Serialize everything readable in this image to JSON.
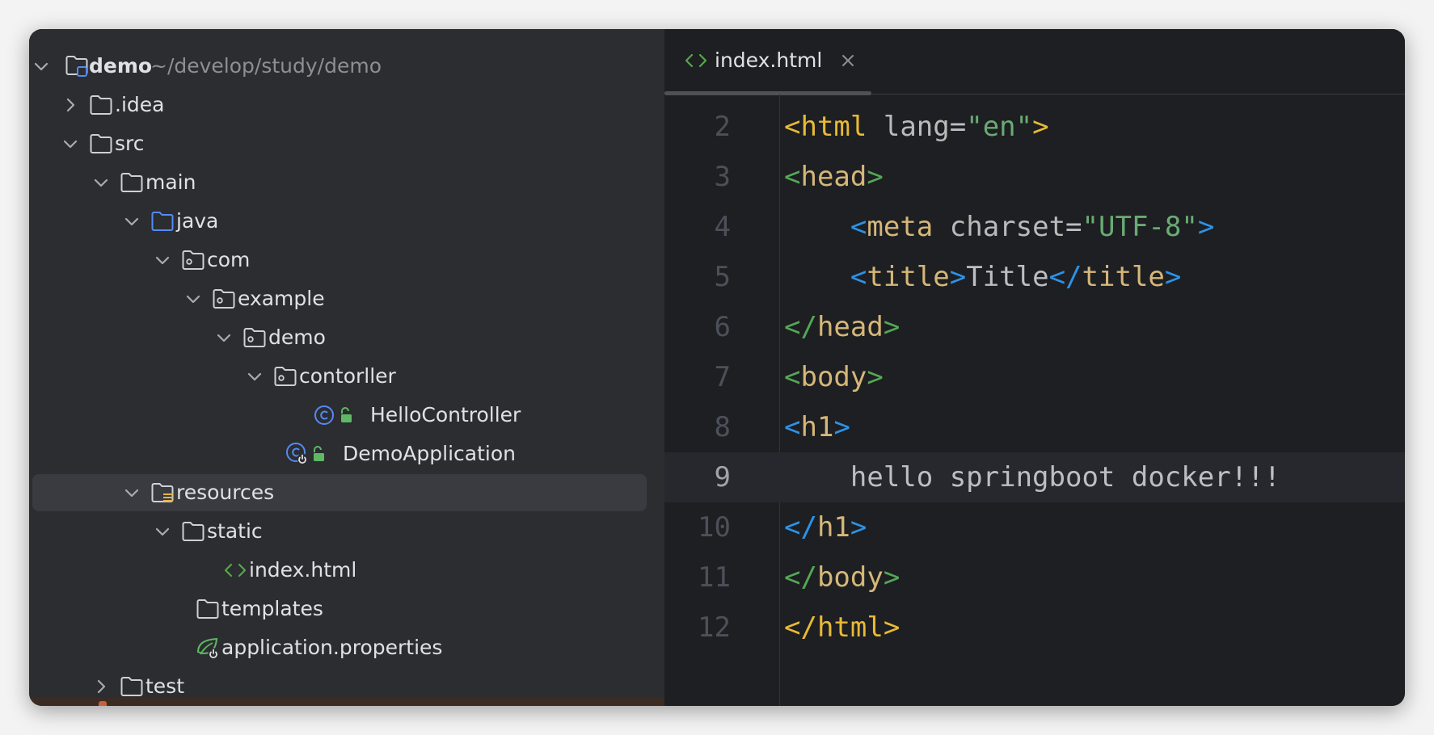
{
  "project_tree": {
    "root": {
      "name": "demo",
      "path": "~/develop/study/demo"
    },
    "items": [
      {
        "label": ".idea",
        "icon": "folder-icon",
        "expanded": false
      },
      {
        "label": "src",
        "icon": "folder-icon",
        "expanded": true
      },
      {
        "label": "main",
        "icon": "folder-icon",
        "expanded": true
      },
      {
        "label": "java",
        "icon": "source-folder-icon",
        "expanded": true
      },
      {
        "label": "com",
        "icon": "package-icon",
        "expanded": true
      },
      {
        "label": "example",
        "icon": "package-icon",
        "expanded": true
      },
      {
        "label": "demo",
        "icon": "package-icon",
        "expanded": true
      },
      {
        "label": "contorller",
        "icon": "package-icon",
        "expanded": true
      },
      {
        "label": "HelloController",
        "icon": "java-class-icon"
      },
      {
        "label": "DemoApplication",
        "icon": "spring-boot-class-icon"
      },
      {
        "label": "resources",
        "icon": "resources-folder-icon",
        "expanded": true,
        "selected": true
      },
      {
        "label": "static",
        "icon": "folder-icon",
        "expanded": true
      },
      {
        "label": "index.html",
        "icon": "html-file-icon"
      },
      {
        "label": "templates",
        "icon": "folder-icon"
      },
      {
        "label": "application.properties",
        "icon": "spring-properties-icon"
      },
      {
        "label": "test",
        "icon": "folder-icon",
        "expanded": false
      }
    ]
  },
  "editor": {
    "tab": {
      "label": "index.html",
      "icon": "html-file-icon"
    },
    "current_line": "9",
    "lines": [
      {
        "number": "2",
        "tokens": [
          [
            "<",
            "orange"
          ],
          [
            "html",
            "orange"
          ],
          [
            " ",
            "text"
          ],
          [
            "lang",
            "attr"
          ],
          [
            "=",
            "eq"
          ],
          [
            "\"en\"",
            "str"
          ],
          [
            ">",
            "orange"
          ]
        ]
      },
      {
        "number": "3",
        "tokens": [
          [
            "<",
            "green"
          ],
          [
            "head",
            "tag"
          ],
          [
            ">",
            "green"
          ]
        ]
      },
      {
        "number": "4",
        "tokens": [
          [
            "    ",
            "text"
          ],
          [
            "<",
            "blue"
          ],
          [
            "meta",
            "tag"
          ],
          [
            " ",
            "text"
          ],
          [
            "charset",
            "attr"
          ],
          [
            "=",
            "eq"
          ],
          [
            "\"UTF-8\"",
            "str"
          ],
          [
            ">",
            "blue"
          ]
        ]
      },
      {
        "number": "5",
        "tokens": [
          [
            "    ",
            "text"
          ],
          [
            "<",
            "blue"
          ],
          [
            "title",
            "tag"
          ],
          [
            ">",
            "blue"
          ],
          [
            "Title",
            "text"
          ],
          [
            "</",
            "blue"
          ],
          [
            "title",
            "tag"
          ],
          [
            ">",
            "blue"
          ]
        ]
      },
      {
        "number": "6",
        "tokens": [
          [
            "</",
            "green"
          ],
          [
            "head",
            "tag"
          ],
          [
            ">",
            "green"
          ]
        ]
      },
      {
        "number": "7",
        "tokens": [
          [
            "<",
            "green"
          ],
          [
            "body",
            "tag"
          ],
          [
            ">",
            "green"
          ]
        ]
      },
      {
        "number": "8",
        "tokens": [
          [
            "<",
            "blue"
          ],
          [
            "h1",
            "tag"
          ],
          [
            ">",
            "blue"
          ]
        ]
      },
      {
        "number": "9",
        "tokens": [
          [
            "    hello springboot docker!!!",
            "text"
          ]
        ]
      },
      {
        "number": "10",
        "tokens": [
          [
            "</",
            "blue"
          ],
          [
            "h1",
            "tag"
          ],
          [
            ">",
            "blue"
          ]
        ]
      },
      {
        "number": "11",
        "tokens": [
          [
            "</",
            "green"
          ],
          [
            "body",
            "tag"
          ],
          [
            ">",
            "green"
          ]
        ]
      },
      {
        "number": "12",
        "tokens": [
          [
            "</",
            "orange"
          ],
          [
            "html",
            "orange"
          ],
          [
            ">",
            "orange"
          ]
        ]
      }
    ]
  },
  "colors": {
    "tree_bg": "#2b2d30",
    "editor_bg": "#1e1f22",
    "selection": "#393b40",
    "folder_stroke": "#ced0d6",
    "source_folder": "#548af7",
    "java_class": "#548af7",
    "spring_green": "#5fb865",
    "html_green": "#57a64a"
  }
}
